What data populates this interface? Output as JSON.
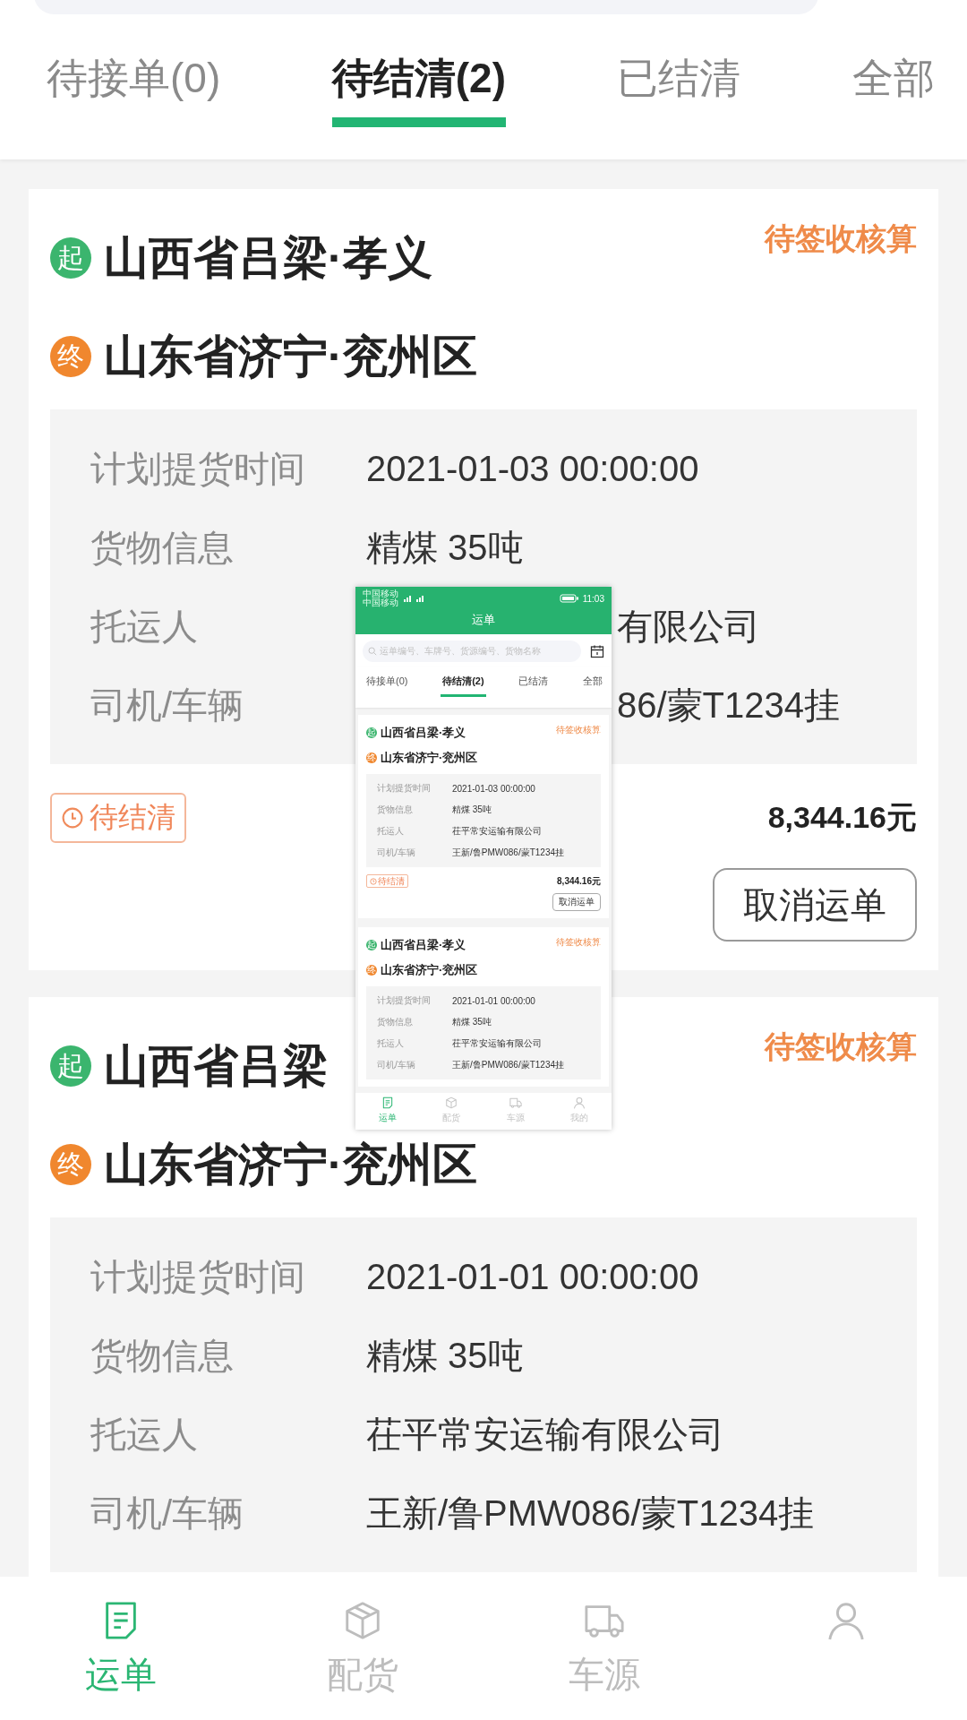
{
  "tabs": [
    {
      "label": "待接单(0)",
      "selected": false
    },
    {
      "label": "待结清(2)",
      "selected": true
    },
    {
      "label": "已结清",
      "selected": false
    },
    {
      "label": "全部",
      "selected": false
    }
  ],
  "orders": [
    {
      "origin_mark": "起",
      "origin": "山西省吕梁·孝义",
      "status": "待签收核算",
      "destination_mark": "终",
      "destination": "山东省济宁·兖州区",
      "details": [
        {
          "label": "计划提货时间",
          "value": "2021-01-03 00:00:00"
        },
        {
          "label": "货物信息",
          "value": "精煤 35吨"
        },
        {
          "label": "托运人",
          "value": "有限公司"
        },
        {
          "label": "司机/车辆",
          "value": "86/蒙T1234挂"
        }
      ],
      "tag": "待结清",
      "price": "8,344.16元",
      "action": "取消运单"
    },
    {
      "origin_mark": "起",
      "origin": "山西省吕梁",
      "status": "待签收核算",
      "destination_mark": "终",
      "destination": "山东省济宁·兖州区",
      "details": [
        {
          "label": "计划提货时间",
          "value": "2021-01-01 00:00:00"
        },
        {
          "label": "货物信息",
          "value": "精煤 35吨"
        },
        {
          "label": "托运人",
          "value": "茌平常安运输有限公司"
        },
        {
          "label": "司机/车辆",
          "value": "王新/鲁PMW086/蒙T1234挂"
        }
      ]
    }
  ],
  "nav": [
    {
      "label": "运单",
      "selected": true
    },
    {
      "label": "配货",
      "selected": false
    },
    {
      "label": "车源",
      "selected": false
    },
    {
      "selected": false
    }
  ],
  "inset": {
    "status_bar": {
      "carriers": [
        "中国移动",
        "中国移动"
      ],
      "time": "11:03"
    },
    "title": "运单",
    "search": {
      "placeholder": "运单编号、车牌号、货源编号、货物名称"
    },
    "tabs": [
      {
        "label": "待接单(0)",
        "selected": false
      },
      {
        "label": "待结清(2)",
        "selected": true
      },
      {
        "label": "已结清",
        "selected": false
      },
      {
        "label": "全部",
        "selected": false
      }
    ],
    "orders": [
      {
        "origin_mark": "起",
        "origin": "山西省吕梁·孝义",
        "status": "待签收核算",
        "destination_mark": "终",
        "destination": "山东省济宁·兖州区",
        "details": [
          {
            "label": "计划提货时间",
            "value": "2021-01-03 00:00:00"
          },
          {
            "label": "货物信息",
            "value": "精煤 35吨"
          },
          {
            "label": "托运人",
            "value": "茌平常安运输有限公司"
          },
          {
            "label": "司机/车辆",
            "value": "王新/鲁PMW086/蒙T1234挂"
          }
        ],
        "tag": "待结清",
        "price": "8,344.16元",
        "action": "取消运单"
      },
      {
        "origin_mark": "起",
        "origin": "山西省吕梁·孝义",
        "status": "待签收核算",
        "destination_mark": "终",
        "destination": "山东省济宁·兖州区",
        "details": [
          {
            "label": "计划提货时间",
            "value": "2021-01-01 00:00:00"
          },
          {
            "label": "货物信息",
            "value": "精煤 35吨"
          },
          {
            "label": "托运人",
            "value": "茌平常安运输有限公司"
          },
          {
            "label": "司机/车辆",
            "value": "王新/鲁PMW086/蒙T1234挂"
          }
        ]
      }
    ],
    "nav": [
      {
        "label": "运单",
        "selected": true
      },
      {
        "label": "配货",
        "selected": false
      },
      {
        "label": "车源",
        "selected": false
      },
      {
        "label": "我的",
        "selected": false
      }
    ]
  }
}
